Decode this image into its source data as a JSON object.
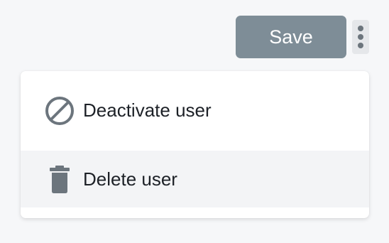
{
  "toolbar": {
    "save_label": "Save",
    "more_icon": "more-vertical-icon"
  },
  "menu": {
    "items": [
      {
        "label": "Deactivate user",
        "icon": "block-icon"
      },
      {
        "label": "Delete user",
        "icon": "trash-icon",
        "state": "hovered"
      }
    ]
  },
  "colors": {
    "background": "#f6f7f9",
    "save_button": "#7e8d97",
    "menu_background": "#ffffff",
    "hover_background": "#f3f4f6",
    "icon": "#6c757d",
    "text": "#1d2127"
  }
}
